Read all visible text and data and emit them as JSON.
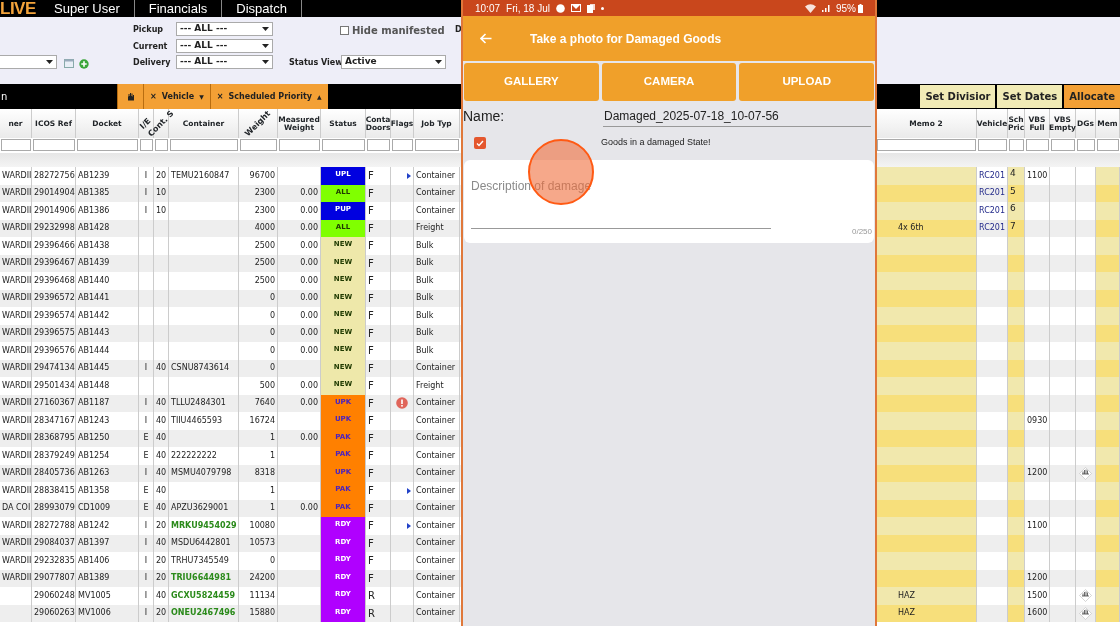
{
  "nav": {
    "logo": "LIVE",
    "items": [
      "Super User",
      "Financials",
      "Dispatch"
    ]
  },
  "filters": {
    "locations": [
      {
        "label": "Pickup",
        "value": "--- ALL ---"
      },
      {
        "label": "Current",
        "value": "--- ALL ---"
      },
      {
        "label": "Delivery",
        "value": "--- ALL ---"
      }
    ],
    "hide_manifested": {
      "label": "Hide manifested",
      "checked": false
    },
    "status_view": {
      "label": "Status View",
      "value": "Active"
    },
    "cut_label": "D"
  },
  "toolbar": {
    "left_text": "n",
    "chips": [
      {
        "kind": "icon"
      },
      {
        "kind": "chip",
        "remove": "×",
        "label": "Vehicle",
        "caret": "▼"
      },
      {
        "kind": "chip",
        "remove": "×",
        "label": "Scheduled Priority",
        "caret": "▲"
      }
    ],
    "buttons": [
      {
        "label": "Set Divisior",
        "kind": "plain"
      },
      {
        "label": "Set Dates",
        "kind": "plain"
      },
      {
        "label": "Allocate",
        "kind": "primary"
      }
    ]
  },
  "table": {
    "left_columns": [
      {
        "label": "ner",
        "kind": "text"
      },
      {
        "label": "ICOS Ref",
        "kind": "text"
      },
      {
        "label": "Docket",
        "kind": "text"
      },
      {
        "label": "I/E",
        "kind": "angled"
      },
      {
        "label": "Cont. S",
        "kind": "angled"
      },
      {
        "label": "Container",
        "kind": "text"
      },
      {
        "label": "Weight",
        "kind": "angled"
      },
      {
        "label": "Measured Weight",
        "kind": "text"
      },
      {
        "label": "Status",
        "kind": "text"
      },
      {
        "label": "Conta Doors",
        "kind": "text"
      },
      {
        "label": "Flags",
        "kind": "text"
      },
      {
        "label": "Job Typ",
        "kind": "text"
      }
    ],
    "right_columns": [
      {
        "label": "Memo 2",
        "kind": "text"
      },
      {
        "label": "Vehicle",
        "kind": "text"
      },
      {
        "label": "Sch Pric",
        "kind": "text"
      },
      {
        "label": "VBS Full",
        "kind": "text"
      },
      {
        "label": "VBS Empty",
        "kind": "text"
      },
      {
        "label": "DGs",
        "kind": "text"
      },
      {
        "label": "Mem",
        "kind": "text"
      }
    ],
    "rows": [
      {
        "owner": "WARDII",
        "icos": "28272756",
        "docket": "AB1239",
        "ie": "I",
        "size": "20",
        "container": "TEMU2160847",
        "container_highlighted": false,
        "weight": "96700",
        "status": "UPL",
        "color": "#0000e0",
        "doors": "F",
        "flag": {
          "kind": "arrow"
        },
        "job": "Container",
        "vehicle": "RC201",
        "prio": "4",
        "vbs_full": "1100",
        "dg": false
      },
      {
        "owner": "WARDII",
        "icos": "29014904",
        "docket": "AB1385",
        "ie": "I",
        "size": "10",
        "container_highlighted": false,
        "weight": "2300",
        "measured": "0.00",
        "status": "ALL",
        "color": "#80ff00",
        "doors": "F",
        "job": "Container",
        "vehicle": "RC201",
        "prio": "5",
        "dg": false
      },
      {
        "owner": "WARDII",
        "icos": "29014906",
        "docket": "AB1386",
        "ie": "I",
        "size": "10",
        "container_highlighted": false,
        "weight": "2300",
        "measured": "0.00",
        "status": "PUP",
        "color": "#0000e0",
        "doors": "F",
        "job": "Container",
        "vehicle": "RC201",
        "prio": "6",
        "dg": false
      },
      {
        "owner": "WARDII",
        "icos": "29232998",
        "docket": "AB1428",
        "container_highlighted": false,
        "weight": "4000",
        "measured": "0.00",
        "status": "ALL",
        "color": "#80ff00",
        "doors": "F",
        "job": "Freight",
        "memo2": "4x 6th",
        "vehicle": "RC201",
        "prio": "7",
        "dg": false
      },
      {
        "owner": "WARDII",
        "icos": "29396466",
        "docket": "AB1438",
        "container_highlighted": false,
        "weight": "2500",
        "measured": "0.00",
        "status": "NEW",
        "color": "#eee8aa",
        "doors": "F",
        "job": "Bulk",
        "dg": false
      },
      {
        "owner": "WARDII",
        "icos": "29396467",
        "docket": "AB1439",
        "container_highlighted": false,
        "weight": "2500",
        "measured": "0.00",
        "status": "NEW",
        "color": "#eee8aa",
        "doors": "F",
        "job": "Bulk",
        "dg": false
      },
      {
        "owner": "WARDII",
        "icos": "29396468",
        "docket": "AB1440",
        "container_highlighted": false,
        "weight": "2500",
        "measured": "0.00",
        "status": "NEW",
        "color": "#eee8aa",
        "doors": "F",
        "job": "Bulk",
        "dg": false
      },
      {
        "owner": "WARDII",
        "icos": "29396572",
        "docket": "AB1441",
        "container_highlighted": false,
        "weight": "0",
        "measured": "0.00",
        "status": "NEW",
        "color": "#eee8aa",
        "doors": "F",
        "job": "Bulk",
        "dg": false
      },
      {
        "owner": "WARDII",
        "icos": "29396574",
        "docket": "AB1442",
        "container_highlighted": false,
        "weight": "0",
        "measured": "0.00",
        "status": "NEW",
        "color": "#eee8aa",
        "doors": "F",
        "job": "Bulk",
        "dg": false
      },
      {
        "owner": "WARDII",
        "icos": "29396575",
        "docket": "AB1443",
        "container_highlighted": false,
        "weight": "0",
        "measured": "0.00",
        "status": "NEW",
        "color": "#eee8aa",
        "doors": "F",
        "job": "Bulk",
        "dg": false
      },
      {
        "owner": "WARDII",
        "icos": "29396576",
        "docket": "AB1444",
        "container_highlighted": false,
        "weight": "0",
        "measured": "0.00",
        "status": "NEW",
        "color": "#eee8aa",
        "doors": "F",
        "job": "Bulk",
        "dg": false
      },
      {
        "owner": "WARDII",
        "icos": "29474134",
        "docket": "AB1445",
        "ie": "I",
        "size": "40",
        "container": "CSNU8743614",
        "container_highlighted": false,
        "weight": "0",
        "status": "NEW",
        "color": "#eee8aa",
        "doors": "F",
        "job": "Container",
        "dg": false
      },
      {
        "owner": "WARDII",
        "icos": "29501434",
        "docket": "AB1448",
        "container_highlighted": false,
        "weight": "500",
        "measured": "0.00",
        "status": "NEW",
        "color": "#eee8aa",
        "doors": "F",
        "job": "Freight",
        "dg": false
      },
      {
        "owner": "WARDII",
        "icos": "27160367",
        "docket": "AB1187",
        "ie": "I",
        "size": "40",
        "container": "TLLU2484301",
        "container_highlighted": false,
        "weight": "7640",
        "measured": "0.00",
        "status": "UPK",
        "color": "#ff8000",
        "doors": "F",
        "flag": {
          "kind": "alert"
        },
        "job": "Container",
        "dg": false
      },
      {
        "owner": "WARDII",
        "icos": "28347167",
        "docket": "AB1243",
        "ie": "I",
        "size": "40",
        "container": "TIIU4465593",
        "container_highlighted": false,
        "weight": "16724",
        "status": "UPK",
        "color": "#ff8000",
        "doors": "F",
        "job": "Container",
        "vbs_full": "0930",
        "dg": false
      },
      {
        "owner": "WARDII",
        "icos": "28368795",
        "docket": "AB1250",
        "ie": "E",
        "size": "40",
        "container_highlighted": false,
        "weight": "1",
        "measured": "0.00",
        "status": "PAK",
        "color": "#ff8000",
        "doors": "F",
        "job": "Container",
        "dg": false
      },
      {
        "owner": "WARDII",
        "icos": "28379249",
        "docket": "AB1254",
        "ie": "E",
        "size": "40",
        "container": "222222222",
        "container_highlighted": false,
        "weight": "1",
        "status": "PAK",
        "color": "#ff8000",
        "doors": "F",
        "job": "Container",
        "dg": false
      },
      {
        "owner": "WARDII",
        "icos": "28405736",
        "docket": "AB1263",
        "ie": "I",
        "size": "40",
        "container": "MSMU4079798",
        "container_highlighted": false,
        "weight": "8318",
        "status": "UPK",
        "color": "#ff8000",
        "doors": "F",
        "job": "Container",
        "vbs_full": "1200",
        "dg": true
      },
      {
        "owner": "WARDII",
        "icos": "28838415",
        "docket": "AB1358",
        "ie": "E",
        "size": "40",
        "container_highlighted": false,
        "weight": "1",
        "status": "PAK",
        "color": "#ff8000",
        "doors": "F",
        "flag": {
          "kind": "arrow"
        },
        "job": "Container",
        "dg": false
      },
      {
        "owner": "DA COI",
        "icos": "28993079",
        "docket": "CD1009",
        "ie": "E",
        "size": "40",
        "container": "APZU3629001",
        "container_highlighted": false,
        "weight": "1",
        "measured": "0.00",
        "status": "PAK",
        "color": "#ff8000",
        "doors": "F",
        "job": "Container",
        "dg": false
      },
      {
        "owner": "WARDII",
        "icos": "28272788",
        "docket": "AB1242",
        "ie": "I",
        "size": "20",
        "container": "MRKU9454029",
        "container_highlighted": true,
        "weight": "10080",
        "status": "RDY",
        "color": "#b000ff",
        "doors": "F",
        "flag": {
          "kind": "arrow"
        },
        "job": "Container",
        "vbs_full": "1100",
        "dg": false
      },
      {
        "owner": "WARDII",
        "icos": "29084037",
        "docket": "AB1397",
        "ie": "I",
        "size": "40",
        "container": "MSDU6442801",
        "container_highlighted": false,
        "weight": "10573",
        "status": "RDY",
        "color": "#b000ff",
        "doors": "F",
        "job": "Container",
        "dg": false
      },
      {
        "owner": "WARDII",
        "icos": "29232835",
        "docket": "AB1406",
        "ie": "I",
        "size": "20",
        "container": "TRHU7345549",
        "container_highlighted": false,
        "weight": "0",
        "status": "RDY",
        "color": "#b000ff",
        "doors": "F",
        "job": "Container",
        "dg": false
      },
      {
        "owner": "WARDII",
        "icos": "29077807",
        "docket": "AB1389",
        "ie": "I",
        "size": "20",
        "container": "TRIU6644981",
        "container_highlighted": true,
        "weight": "24200",
        "status": "RDY",
        "color": "#b000ff",
        "doors": "F",
        "job": "Container",
        "vbs_full": "1200",
        "dg": false
      },
      {
        "icos": "29060248",
        "docket": "MV1005",
        "ie": "I",
        "size": "40",
        "container": "GCXU5824459",
        "container_highlighted": true,
        "weight": "11134",
        "status": "RDY",
        "color": "#b000ff",
        "doors": "R",
        "job": "Container",
        "memo2": "HAZ",
        "vbs_full": "1500",
        "dg": true
      },
      {
        "icos": "29060263",
        "docket": "MV1006",
        "ie": "I",
        "size": "20",
        "container": "ONEU2467496",
        "container_highlighted": true,
        "weight": "15880",
        "status": "RDY",
        "color": "#b000ff",
        "doors": "R",
        "job": "Container",
        "memo2": "HAZ",
        "vbs_full": "1600",
        "dg": true
      }
    ]
  },
  "phone": {
    "status_bar": {
      "time": "10:07",
      "date": "Fri, 18 Jul",
      "battery": "95%"
    },
    "title": "Take a photo for Damaged Goods",
    "buttons": [
      "GALLERY",
      "CAMERA",
      "UPLOAD"
    ],
    "name": {
      "label": "Name:",
      "value": "Damaged_2025-07-18_10-07-56"
    },
    "damaged": {
      "label": "Goods in a damaged State!",
      "checked": true
    },
    "description": {
      "placeholder": "Description of damage",
      "counter": "0/250"
    }
  }
}
